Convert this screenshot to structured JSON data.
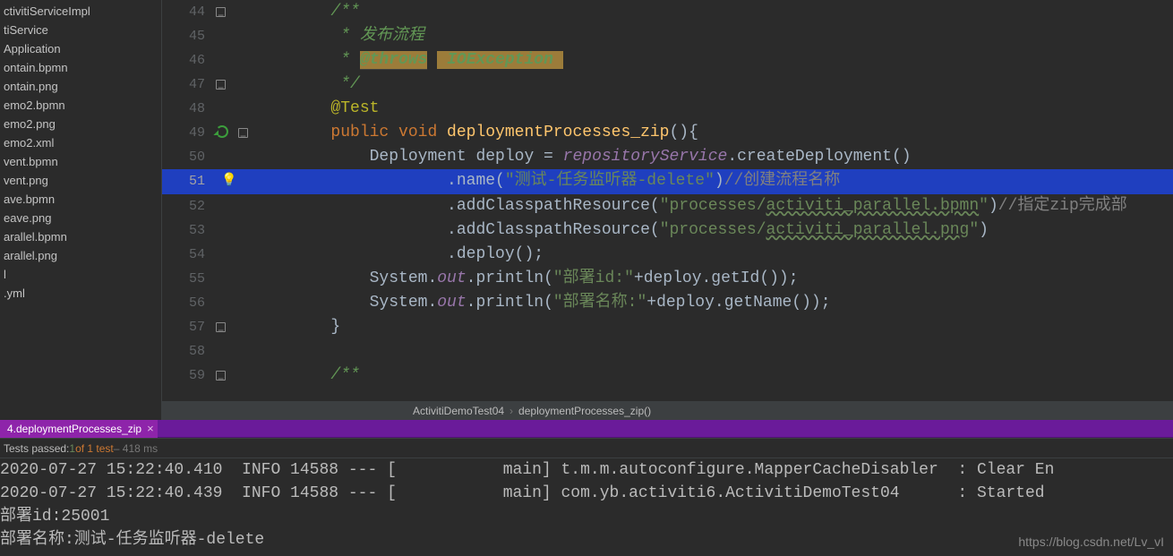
{
  "sidebar": {
    "files": [
      "ctivitiServiceImpl",
      "tiService",
      "Application",
      "",
      "ontain.bpmn",
      "ontain.png",
      "emo2.bpmn",
      "emo2.png",
      "emo2.xml",
      "vent.bpmn",
      "vent.png",
      "ave.bpmn",
      "eave.png",
      "arallel.bpmn",
      "arallel.png",
      "l",
      ".yml"
    ]
  },
  "editor": {
    "lines": [
      {
        "num": 44,
        "fold": "minus",
        "tokens": [
          {
            "cls": "doc-cmt",
            "text": "/**"
          }
        ]
      },
      {
        "num": 45,
        "tokens": [
          {
            "cls": "doc-cmt",
            "text": " * 发布流程"
          }
        ]
      },
      {
        "num": 46,
        "tokens": [
          {
            "cls": "doc-cmt",
            "text": " * "
          },
          {
            "cls": "doc-tag",
            "text": "@throws"
          },
          {
            "cls": "doc-cmt",
            "text": " "
          },
          {
            "cls": "doc-tag2",
            "text": " IOException "
          }
        ]
      },
      {
        "num": 47,
        "fold": "minus",
        "tokens": [
          {
            "cls": "doc-cmt",
            "text": " */"
          }
        ]
      },
      {
        "num": 48,
        "tokens": [
          {
            "cls": "anno",
            "text": "@Test"
          }
        ]
      },
      {
        "num": 49,
        "fold": "minus",
        "reload": true,
        "tokens": [
          {
            "cls": "kw",
            "text": "public void "
          },
          {
            "cls": "mname",
            "text": "deploymentProcesses_zip"
          },
          {
            "cls": "",
            "text": "(){"
          }
        ]
      },
      {
        "num": 50,
        "tokens": [
          {
            "cls": "",
            "text": "    Deployment deploy = "
          },
          {
            "cls": "field",
            "text": "repositoryService"
          },
          {
            "cls": "",
            "text": ".createDeployment()"
          }
        ]
      },
      {
        "num": 51,
        "hl": true,
        "bulb": true,
        "tokens": [
          {
            "cls": "",
            "text": "            .name("
          },
          {
            "cls": "str",
            "text": "\"测试-任务监听器-delete\""
          },
          {
            "cls": "",
            "text": ")"
          },
          {
            "cls": "linecmt",
            "text": "//创建流程名称"
          }
        ]
      },
      {
        "num": 52,
        "tokens": [
          {
            "cls": "",
            "text": "            .addClasspathResource("
          },
          {
            "cls": "str",
            "text": "\"processes/"
          },
          {
            "cls": "str path-underline",
            "text": "activiti_parallel.bpmn"
          },
          {
            "cls": "str",
            "text": "\""
          },
          {
            "cls": "",
            "text": ")"
          },
          {
            "cls": "linecmt",
            "text": "//指定zip完成部"
          }
        ]
      },
      {
        "num": 53,
        "tokens": [
          {
            "cls": "",
            "text": "            .addClasspathResource("
          },
          {
            "cls": "str",
            "text": "\"processes/"
          },
          {
            "cls": "str path-underline",
            "text": "activiti_parallel.png"
          },
          {
            "cls": "str",
            "text": "\""
          },
          {
            "cls": "",
            "text": ")"
          }
        ]
      },
      {
        "num": 54,
        "tokens": [
          {
            "cls": "",
            "text": "            .deploy();"
          }
        ]
      },
      {
        "num": 55,
        "tokens": [
          {
            "cls": "",
            "text": "    System."
          },
          {
            "cls": "field",
            "text": "out"
          },
          {
            "cls": "",
            "text": ".println("
          },
          {
            "cls": "str",
            "text": "\"部署id:\""
          },
          {
            "cls": "",
            "text": "+deploy.getId());"
          }
        ]
      },
      {
        "num": 56,
        "tokens": [
          {
            "cls": "",
            "text": "    System."
          },
          {
            "cls": "field",
            "text": "out"
          },
          {
            "cls": "",
            "text": ".println("
          },
          {
            "cls": "str",
            "text": "\"部署名称:\""
          },
          {
            "cls": "",
            "text": "+deploy.getName());"
          }
        ]
      },
      {
        "num": 57,
        "fold": "minus",
        "tokens": [
          {
            "cls": "",
            "text": "}"
          }
        ]
      },
      {
        "num": 58,
        "tokens": [
          {
            "cls": "",
            "text": ""
          }
        ]
      },
      {
        "num": 59,
        "fold": "minus",
        "tokens": [
          {
            "cls": "doc-cmt",
            "text": "/**"
          }
        ]
      }
    ],
    "breadcrumb": {
      "cls": "ActivitiDemoTest04",
      "method": "deploymentProcesses_zip()"
    }
  },
  "tab": {
    "label": "4.deploymentProcesses_zip",
    "close": "×"
  },
  "status": {
    "label": "Tests passed: ",
    "passed": "1",
    "of": " of 1 test",
    "time": " – 418 ms"
  },
  "console": [
    "2020-07-27 15:22:40.410  INFO 14588 --- [           main] t.m.m.autoconfigure.MapperCacheDisabler  : Clear En",
    "2020-07-27 15:22:40.439  INFO 14588 --- [           main] com.yb.activiti6.ActivitiDemoTest04      : Started ",
    "部署id:25001",
    "部署名称:测试-任务监听器-delete"
  ],
  "watermark": "https://blog.csdn.net/Lv_vI"
}
